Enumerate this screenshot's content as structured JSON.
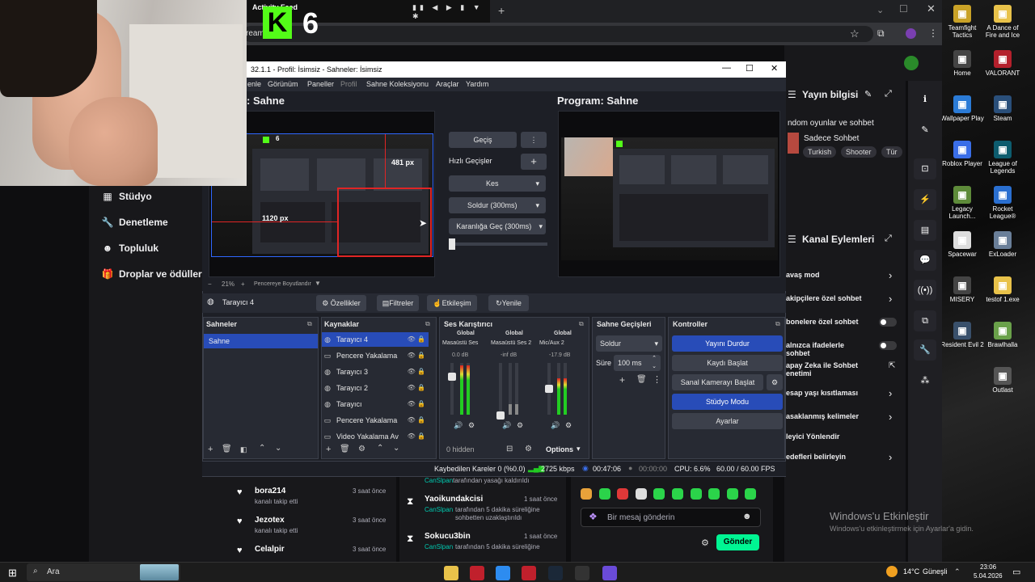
{
  "browser": {
    "tab_title": "Activity Feed",
    "overlay_number": "6",
    "addr_fragment": "ream"
  },
  "twitch_nav": [
    {
      "label": "Stüdyo",
      "icon": "studio-icon"
    },
    {
      "label": "Denetleme",
      "icon": "wrench-icon"
    },
    {
      "label": "Topluluk",
      "icon": "community-icon"
    },
    {
      "label": "Droplar ve ödüller",
      "icon": "gift-icon"
    }
  ],
  "obs": {
    "title": "32.1.1 - Profil: İsimsiz - Sahneler: İsimsiz",
    "menu": [
      "enle",
      "Görünüm",
      "Paneller",
      "Profil",
      "Sahne Koleksiyonu",
      "Araçlar",
      "Yardım"
    ],
    "preview_title": ": Sahne",
    "program_title": "Program: Sahne",
    "preview_label_width": "1120 px",
    "preview_label_height": "481 px",
    "preview_mini_num": "6",
    "zoom_text": "21%",
    "zoom_mode": "Pencereye Boyutlandır",
    "transition": {
      "gecis": "Geçiş",
      "hizli": "Hızlı Geçişler",
      "kes": "Kes",
      "soldur": "Soldur (300ms)",
      "karanlik": "Karanlığa Geç (300ms)"
    },
    "source_toolbar": {
      "selected": "Tarayıcı 4",
      "ozellikler": "Özellikler",
      "filtreler": "Filtreler",
      "etkilesim": "Etkileşim",
      "yenile": "Yenile"
    },
    "docks": {
      "sahneler": "Sahneler",
      "kaynaklar": "Kaynaklar",
      "ses": "Ses Karıştırıcı",
      "gecisler": "Sahne Geçişleri",
      "kontroller": "Kontroller"
    },
    "scenes": [
      "Sahne"
    ],
    "sources": [
      "Tarayıcı 4",
      "Pencere Yakalama",
      "Tarayıcı 3",
      "Tarayıcı 2",
      "Tarayıcı",
      "Pencere Yakalama",
      "Video Yakalama Av"
    ],
    "mixer": [
      {
        "tag": "Global",
        "name": "Masaüstü Ses",
        "db": "0.0 dB",
        "level": 0.8
      },
      {
        "tag": "Global",
        "name": "Masaüstü Ses 2",
        "db": "-inf dB",
        "level": 0.0
      },
      {
        "tag": "Global",
        "name": "Mic/Aux 2",
        "db": "-17.9 dB",
        "level": 0.55
      }
    ],
    "mixer_hidden": "0 hidden",
    "mixer_options": "Options",
    "scene_transition": {
      "value": "Soldur",
      "sure_label": "Süre",
      "sure_value": "100 ms"
    },
    "controls": [
      "Yayını Durdur",
      "Kaydı Başlat",
      "Sanal Kamerayı Başlat",
      "Stüdyo Modu",
      "Ayarlar"
    ],
    "status": {
      "dropped": "Kaybedilen Kareler 0 (%0.0)",
      "kbps": "2725 kbps",
      "stream_time": "00:47:06",
      "rec_time": "00:00:00",
      "cpu": "CPU: 6.6%",
      "fps": "60.00 / 60.00 FPS"
    }
  },
  "stream_info": {
    "heading": "Yayın bilgisi",
    "title": "ndom oyunlar ve sohbet",
    "subtitle": "Sadece Sohbet",
    "tags": [
      "Turkish",
      "Shooter",
      "Tür"
    ]
  },
  "channel_actions": {
    "heading": "Kanal Eylemleri",
    "items": [
      {
        "label": "avaş mod",
        "control": "chevron"
      },
      {
        "label": "akipçilere özel sohbet",
        "control": "chevron"
      },
      {
        "label": "bonelere özel sohbet",
        "control": "toggle"
      },
      {
        "label": "alnızca ifadelerle sohbet",
        "control": "toggle"
      },
      {
        "label": "apay Zeka ile Sohbet enetimi",
        "control": "external"
      },
      {
        "label": "esap yaşı kısıtlaması",
        "control": "chevron"
      },
      {
        "label": "asaklanmış kelimeler",
        "control": "chevron"
      },
      {
        "label": "leyici Yönlendir",
        "control": "none"
      },
      {
        "label": "edefleri belirleyin",
        "control": "chevron"
      }
    ]
  },
  "activity": [
    {
      "name": "",
      "text": "tarafından yasağı kaldırıldı",
      "mod": "CanSlpan",
      "time": ""
    },
    {
      "name": "bora214",
      "text": "kanalı takip etti",
      "time": "3 saat önce"
    },
    {
      "name": "Jezotex",
      "text": "kanalı takip etti",
      "time": "3 saat önce"
    },
    {
      "name": "Celalpir",
      "text": "",
      "time": "3 saat önce"
    },
    {
      "name": "Yaoikundakcisi",
      "mod": "CanSlpan",
      "text": "tarafından 5 dakika süreliğine sohbetten uzaklaştırıldı",
      "time": "1 saat önce"
    },
    {
      "name": "Sokucu3bin",
      "mod": "CanSlpan",
      "text": "tarafından 5 dakika süreliğine",
      "time": "1 saat önce"
    }
  ],
  "chat": {
    "placeholder": "Bir mesaj gönderin",
    "send": "Gönder"
  },
  "activation": {
    "title": "Windows'u Etkinleştir",
    "sub": "Windows'u etkinleştirmek için Ayarlar'a gidin."
  },
  "desktop_icons": [
    {
      "label": "Teamfight Tactics",
      "color": "#c9a227"
    },
    {
      "label": "A Dance of Fire and Ice",
      "color": "#e8c24a"
    },
    {
      "label": "Home",
      "color": "#444"
    },
    {
      "label": "VALORANT",
      "color": "#b4202c"
    },
    {
      "label": "Wallpaper Play",
      "color": "#2b7bd6"
    },
    {
      "label": "Steam",
      "color": "#2a4f7a"
    },
    {
      "label": "Roblox Player",
      "color": "#3a6ee8"
    },
    {
      "label": "League of Legends",
      "color": "#0d5c6e"
    },
    {
      "label": "Legacy Launch...",
      "color": "#5e8b3a"
    },
    {
      "label": "Rocket League®",
      "color": "#2a6fd0"
    },
    {
      "label": "Spacewar",
      "color": "#ddd"
    },
    {
      "label": "ExLoader",
      "color": "#6a7f99"
    },
    {
      "label": "MISERY",
      "color": "#444"
    },
    {
      "label": "testof 1.exe",
      "color": "#e8c24a"
    },
    {
      "label": "Resident Evil 2",
      "color": "#39506b"
    },
    {
      "label": "Brawlhalla",
      "color": "#6aa14a"
    },
    {
      "label": "Outlast",
      "color": "#555"
    }
  ],
  "taskbar": {
    "search": "Ara",
    "weather": "14°C",
    "weather_desc": "Güneşli",
    "time": "23:06",
    "date": "5.04.2026"
  },
  "colors": {
    "obs_blue": "#284cb8",
    "twitch_send": "#00f593",
    "kick_green": "#53fc18"
  }
}
